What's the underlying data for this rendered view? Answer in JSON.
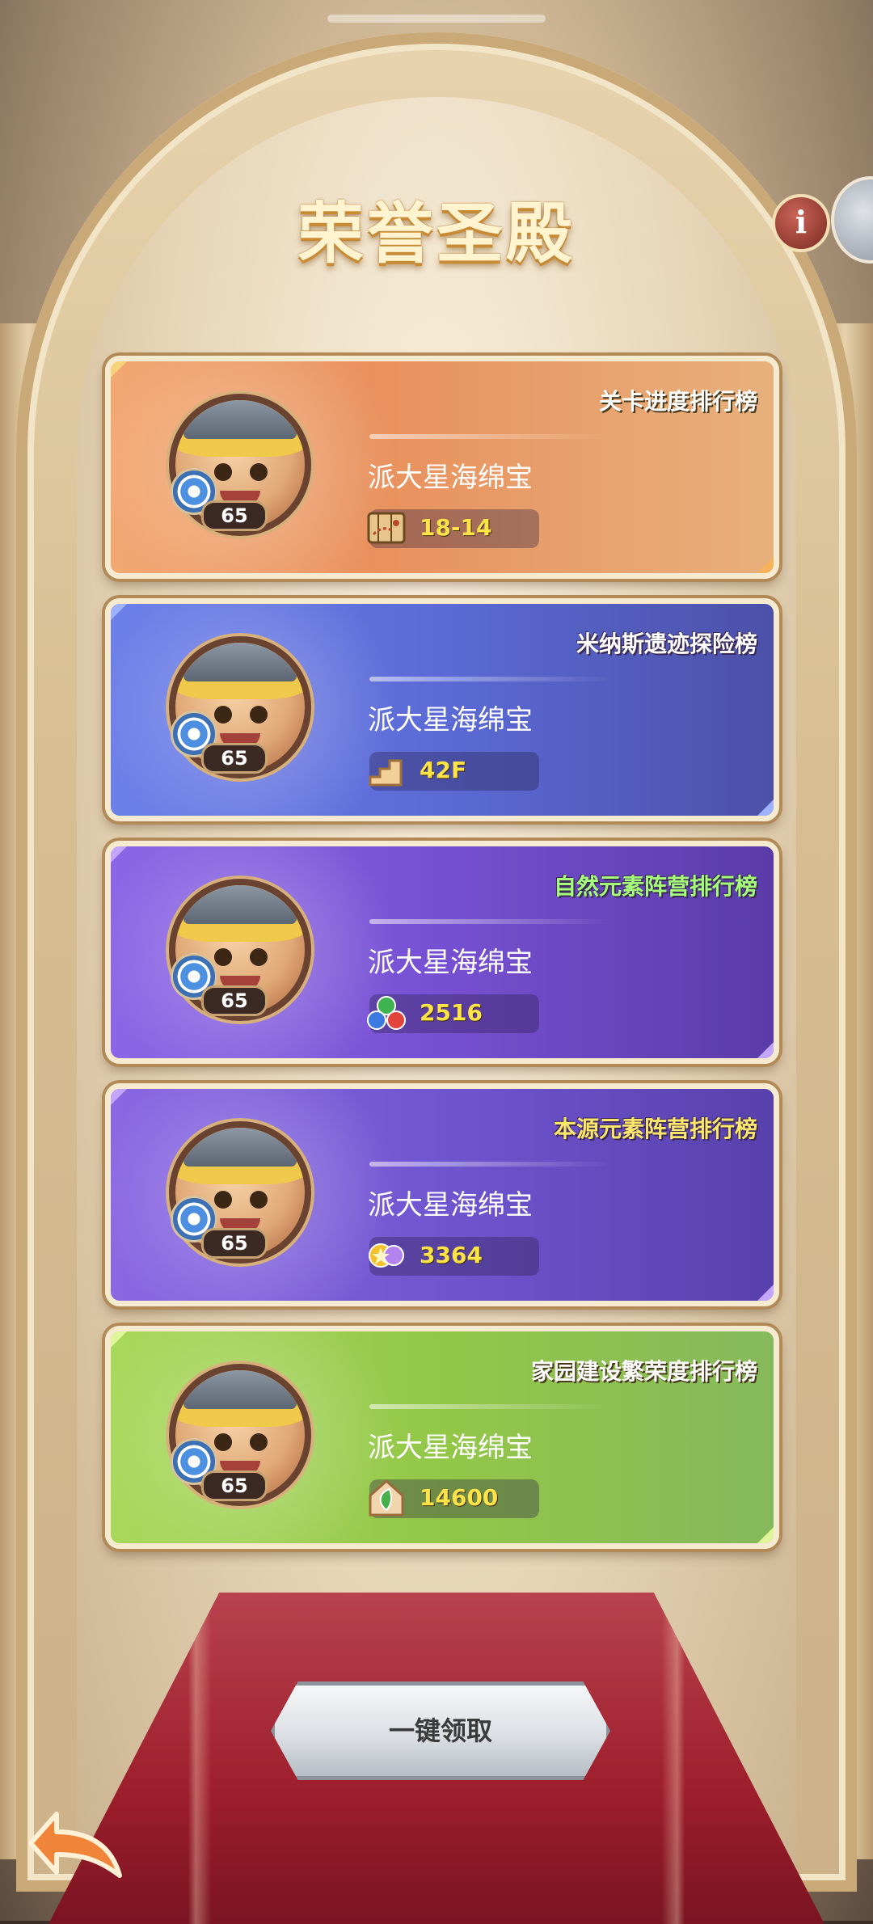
{
  "title": "荣誉圣殿",
  "info_button": "i",
  "claim_button": "一键领取",
  "cards": [
    {
      "title": "关卡进度排行榜",
      "player": "派大星海绵宝",
      "level": "65",
      "stat": "18-14",
      "stat_icon": "map-icon",
      "theme": "orange"
    },
    {
      "title": "米纳斯遗迹探险榜",
      "player": "派大星海绵宝",
      "level": "65",
      "stat": "42F",
      "stat_icon": "stairs-icon",
      "theme": "blue"
    },
    {
      "title": "自然元素阵营排行榜",
      "player": "派大星海绵宝",
      "level": "65",
      "stat": "2516",
      "stat_icon": "nature-elements-icon",
      "theme": "purple"
    },
    {
      "title": "本源元素阵营排行榜",
      "player": "派大星海绵宝",
      "level": "65",
      "stat": "3364",
      "stat_icon": "origin-elements-icon",
      "theme": "violet"
    },
    {
      "title": "家园建设繁荣度排行榜",
      "player": "派大星海绵宝",
      "level": "65",
      "stat": "14600",
      "stat_icon": "home-leaf-icon",
      "theme": "green"
    }
  ],
  "colors": {
    "stat_value": "#ffe347",
    "title": "#fff4cf",
    "card_title_green": "#a6ff7a",
    "card_title_yellow": "#ffe76b"
  }
}
